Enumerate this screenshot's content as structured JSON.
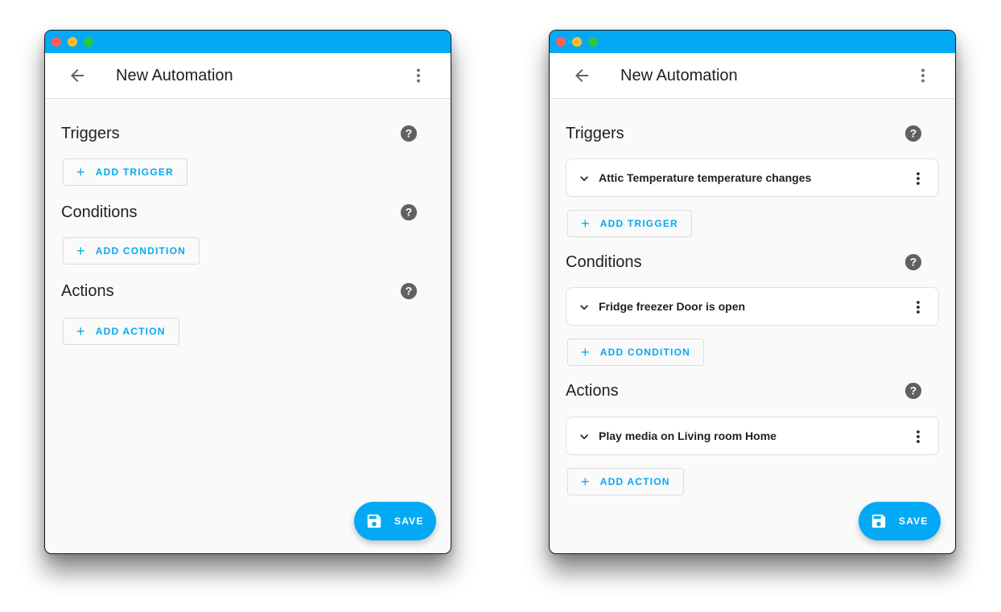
{
  "windows": [
    {
      "title": "New Automation",
      "sections": [
        {
          "title": "Triggers",
          "items": [],
          "add_label": "ADD TRIGGER"
        },
        {
          "title": "Conditions",
          "items": [],
          "add_label": "ADD CONDITION"
        },
        {
          "title": "Actions",
          "items": [],
          "add_label": "ADD ACTION"
        }
      ],
      "save_label": "SAVE"
    },
    {
      "title": "New Automation",
      "sections": [
        {
          "title": "Triggers",
          "items": [
            "Attic Temperature temperature changes"
          ],
          "add_label": "ADD TRIGGER"
        },
        {
          "title": "Conditions",
          "items": [
            "Fridge freezer Door is open"
          ],
          "add_label": "ADD CONDITION"
        },
        {
          "title": "Actions",
          "items": [
            "Play media on Living room Home"
          ],
          "add_label": "ADD ACTION"
        }
      ],
      "save_label": "SAVE"
    }
  ],
  "icons": {
    "back": "arrow-left-icon",
    "more": "dots-vertical-icon",
    "help": "help-circle-icon",
    "add": "plus-icon",
    "expand": "chevron-down-icon",
    "save": "floppy-disk-icon"
  },
  "colors": {
    "accent": "#03a9f4",
    "titlebar": "#03a9f4",
    "background": "#fafafa",
    "text": "#212121",
    "icon_gray": "#616161"
  }
}
